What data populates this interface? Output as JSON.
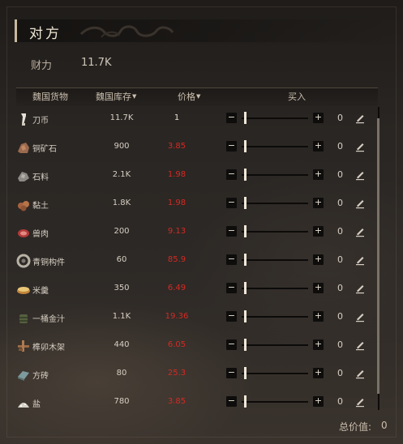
{
  "panel": {
    "title": "对方",
    "wealth_label": "财力",
    "wealth_value": "11.7K"
  },
  "table": {
    "headers": {
      "goods": "魏国货物",
      "stock": "魏国库存",
      "price": "价格",
      "buy": "买入"
    },
    "sort_icon": "caret-down-icon",
    "rows": [
      {
        "icon": "coin-knife-icon",
        "name": "刀币",
        "stock": "11.7K",
        "price": "1",
        "price_color": "#e6ddcf",
        "quantity": "0"
      },
      {
        "icon": "copper-ore-icon",
        "name": "铜矿石",
        "stock": "900",
        "price": "3.85",
        "price_color": "#d42a23",
        "quantity": "0"
      },
      {
        "icon": "stone-icon",
        "name": "石料",
        "stock": "2.1K",
        "price": "1.98",
        "price_color": "#d42a23",
        "quantity": "0"
      },
      {
        "icon": "clay-icon",
        "name": "黏土",
        "stock": "1.8K",
        "price": "1.98",
        "price_color": "#d42a23",
        "quantity": "0"
      },
      {
        "icon": "meat-icon",
        "name": "兽肉",
        "stock": "200",
        "price": "9.13",
        "price_color": "#d42a23",
        "quantity": "0"
      },
      {
        "icon": "bronze-part-icon",
        "name": "青铜构件",
        "stock": "60",
        "price": "85.9",
        "price_color": "#d42a23",
        "quantity": "0"
      },
      {
        "icon": "rice-porridge-icon",
        "name": "米羹",
        "stock": "350",
        "price": "6.49",
        "price_color": "#d42a23",
        "quantity": "0"
      },
      {
        "icon": "gold-juice-icon",
        "name": "一桶金汁",
        "stock": "1.1K",
        "price": "19.36",
        "price_color": "#d42a23",
        "quantity": "0"
      },
      {
        "icon": "mortise-frame-icon",
        "name": "榫卯木架",
        "stock": "440",
        "price": "6.05",
        "price_color": "#d42a23",
        "quantity": "0"
      },
      {
        "icon": "brick-icon",
        "name": "方砖",
        "stock": "80",
        "price": "25.3",
        "price_color": "#d42a23",
        "quantity": "0"
      },
      {
        "icon": "salt-icon",
        "name": "盐",
        "stock": "780",
        "price": "3.85",
        "price_color": "#d42a23",
        "quantity": "0"
      }
    ],
    "slider_value": 0,
    "controls": {
      "minus": "−",
      "plus": "+"
    }
  },
  "footer": {
    "total_label": "总价值:",
    "total_value": "0"
  },
  "colors": {
    "price_up": "#d42a23",
    "thumb": "#efe7d8",
    "title_accent": "#c8b89e"
  }
}
